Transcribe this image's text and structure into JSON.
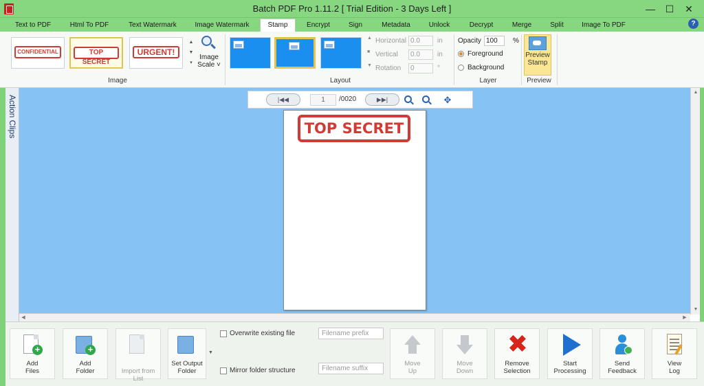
{
  "window": {
    "title": "Batch PDF Pro 1.11.2 [ Trial Edition - 3 Days Left ]",
    "minimize": "—",
    "maximize": "☐",
    "close": "✕"
  },
  "tabs": [
    {
      "label": "Text to PDF"
    },
    {
      "label": "Html To PDF"
    },
    {
      "label": "Text Watermark"
    },
    {
      "label": "Image Watermark"
    },
    {
      "label": "Stamp",
      "active": true
    },
    {
      "label": "Encrypt"
    },
    {
      "label": "Sign"
    },
    {
      "label": "Metadata"
    },
    {
      "label": "Unlock"
    },
    {
      "label": "Decrypt"
    },
    {
      "label": "Merge"
    },
    {
      "label": "Split"
    },
    {
      "label": "Image To PDF"
    }
  ],
  "help": "?",
  "ribbon": {
    "image_group": {
      "label": "Image",
      "stamps": [
        "CONFIDENTIAL",
        "TOP SECRET",
        "URGENT!"
      ],
      "selected_index": 1,
      "scale_label": "Image\nScale ˅"
    },
    "layout_group": {
      "label": "Layout",
      "horizontal": {
        "label": "Horizontal",
        "value": "0.0",
        "unit": "in"
      },
      "vertical": {
        "label": "Vertical",
        "value": "0.0",
        "unit": "in"
      },
      "rotation": {
        "label": "Rotation",
        "value": "0",
        "unit": "°"
      }
    },
    "layer_group": {
      "label": "Layer",
      "opacity_label": "Opacity",
      "opacity_value": "100",
      "opacity_unit": "%",
      "foreground": "Foreground",
      "background": "Background"
    },
    "preview_group": {
      "label": "Preview",
      "button": "Preview\nStamp"
    }
  },
  "action_clips": "Action Clips",
  "pager": {
    "first": "|◀◀",
    "current": "1",
    "total": "/0020",
    "last": "▶▶|"
  },
  "page_preview": {
    "stamp_text": "TOP SECRET"
  },
  "bottom": {
    "add_files": "Add\nFiles",
    "add_folder": "Add\nFolder",
    "import_list": "Import from List",
    "set_output": "Set Output\nFolder",
    "overwrite": "Overwrite existing file",
    "mirror": "Mirror folder structure",
    "prefix_placeholder": "Filename prefix",
    "suffix_placeholder": "Filename suffix",
    "move_up": "Move\nUp",
    "move_down": "Move\nDown",
    "remove": "Remove\nSelection",
    "start": "Start\nProcessing",
    "feedback": "Send\nFeedback",
    "view_log": "View\nLog"
  },
  "colors": {
    "title_green": "#86d77f",
    "workspace_blue": "#86c3f4",
    "stamp_red": "#d13b36",
    "selection_gold": "#e4c44e"
  }
}
